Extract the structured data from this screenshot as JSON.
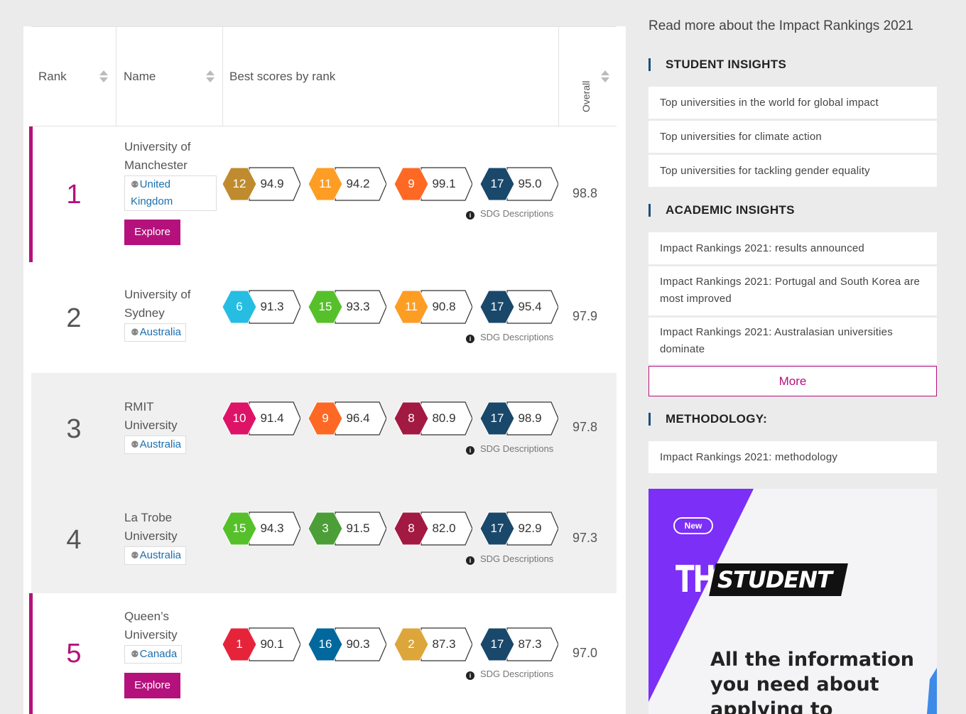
{
  "table": {
    "headers": {
      "rank": "Rank",
      "name": "Name",
      "scores": "Best scores by rank",
      "overall": "Overall"
    },
    "sdg_desc_label": "SDG Descriptions",
    "explore_label": "Explore",
    "rows": [
      {
        "rank": "1",
        "name": "University of Manchester",
        "country": "United Kingdom",
        "overall": "98.8",
        "scores": [
          {
            "sdg": "12",
            "score": "94.9",
            "color": "#bf8b2e"
          },
          {
            "sdg": "11",
            "score": "94.2",
            "color": "#fd9d24"
          },
          {
            "sdg": "9",
            "score": "99.1",
            "color": "#fd6925"
          },
          {
            "sdg": "17",
            "score": "95.0",
            "color": "#19486a"
          }
        ]
      },
      {
        "rank": "2",
        "name": "University of Sydney",
        "country": "Australia",
        "overall": "97.9",
        "scores": [
          {
            "sdg": "6",
            "score": "91.3",
            "color": "#26bde2"
          },
          {
            "sdg": "15",
            "score": "93.3",
            "color": "#56c02b"
          },
          {
            "sdg": "11",
            "score": "90.8",
            "color": "#fd9d24"
          },
          {
            "sdg": "17",
            "score": "95.4",
            "color": "#19486a"
          }
        ]
      },
      {
        "rank": "3",
        "name": "RMIT University",
        "country": "Australia",
        "overall": "97.8",
        "scores": [
          {
            "sdg": "10",
            "score": "91.4",
            "color": "#dd1367"
          },
          {
            "sdg": "9",
            "score": "96.4",
            "color": "#fd6925"
          },
          {
            "sdg": "8",
            "score": "80.9",
            "color": "#a21942"
          },
          {
            "sdg": "17",
            "score": "98.9",
            "color": "#19486a"
          }
        ]
      },
      {
        "rank": "4",
        "name": "La Trobe University",
        "country": "Australia",
        "overall": "97.3",
        "scores": [
          {
            "sdg": "15",
            "score": "94.3",
            "color": "#56c02b"
          },
          {
            "sdg": "3",
            "score": "91.5",
            "color": "#4c9f38"
          },
          {
            "sdg": "8",
            "score": "82.0",
            "color": "#a21942"
          },
          {
            "sdg": "17",
            "score": "92.9",
            "color": "#19486a"
          }
        ]
      },
      {
        "rank": "5",
        "name": "Queen’s University",
        "country": "Canada",
        "overall": "97.0",
        "scores": [
          {
            "sdg": "1",
            "score": "90.1",
            "color": "#e5243b"
          },
          {
            "sdg": "16",
            "score": "90.3",
            "color": "#00689d"
          },
          {
            "sdg": "2",
            "score": "87.3",
            "color": "#dda63a"
          },
          {
            "sdg": "17",
            "score": "87.3",
            "color": "#19486a"
          }
        ]
      }
    ]
  },
  "sidebar": {
    "read_more": "Read more about the Impact Rankings 2021",
    "student_title": "STUDENT INSIGHTS",
    "student_links": [
      "Top universities in the world for global impact",
      "Top universities for climate action",
      "Top universities for tackling gender equality"
    ],
    "academic_title": "ACADEMIC INSIGHTS",
    "academic_links": [
      "Impact Rankings 2021: results announced",
      "Impact Rankings 2021: Portugal and South Korea are most improved",
      "Impact Rankings 2021: Australasian universities dominate"
    ],
    "more_label": "More",
    "methodology_title": "METHODOLOGY:",
    "methodology_links": [
      "Impact Rankings 2021: methodology"
    ]
  },
  "ad": {
    "pill": "New",
    "brand_the": "THE",
    "brand_student": "STUDENT",
    "text": "All the information you need about applying to university",
    "accent_color": "#7b2ff7"
  }
}
